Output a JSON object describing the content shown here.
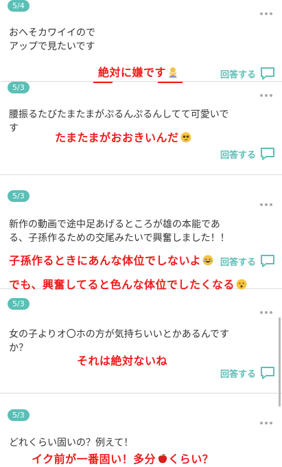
{
  "cards": [
    {
      "date": "5/4",
      "question": "おへそカワイイので\nアップで見たいです",
      "answer_label": "回答する"
    },
    {
      "date": "5/3",
      "question": "腰振るたびたまたまがぷるんぷるんしてて可愛いで\nす",
      "answer_label": "回答する"
    },
    {
      "date": "5/3",
      "question": "新作の動画で途中足あげるところが雄の本能であ\nる、子孫作るための交尾みたいで興奮しました！！",
      "answer_label": "回答する"
    },
    {
      "date": "5/3",
      "question": "女の子よりオ〇ホの方が気持ちいいとかあるんです\nか？",
      "answer_label": "回答する"
    },
    {
      "date": "5/3",
      "question": "どれくらい固いの？例えて！"
    }
  ],
  "overlays": {
    "a1": "絶対に嫌です",
    "a2": "たまたまがおおきいんだ",
    "a3_line1": "子孫作るときにあんな体位でしないよ",
    "a3_line2": "でも、興奮してると色んな体位でしたくなる",
    "a4": "それは絶対ないね",
    "a5_pre": "イク前が一番固い！多分",
    "a5_post": "くらい？"
  },
  "colors": {
    "accent": "#5bbfb6",
    "overlay": "#ef1b1b"
  }
}
